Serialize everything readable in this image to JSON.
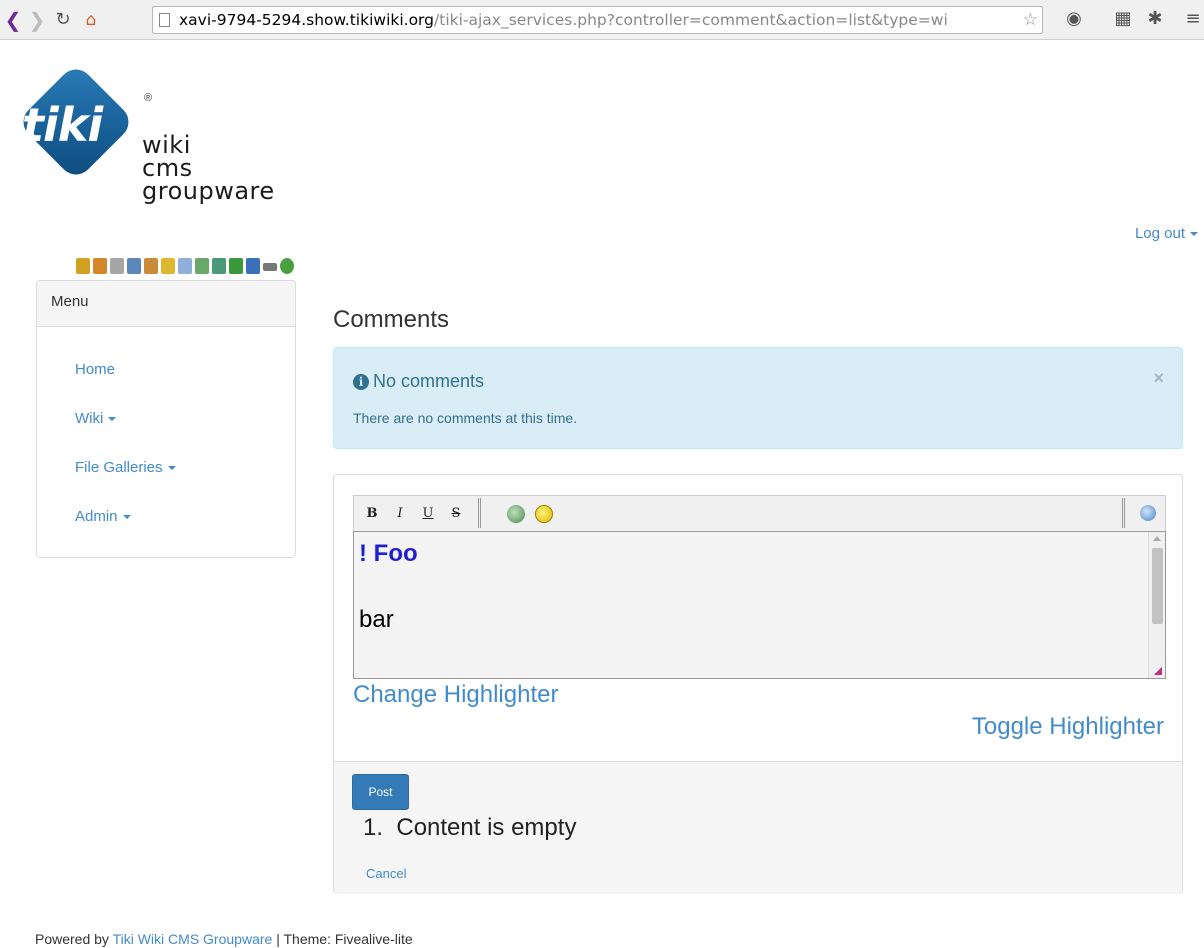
{
  "browser": {
    "url_host": "xavi-9794-5294.show.tikiwiki.org",
    "url_path": "/tiki-ajax_services.php?controller=comment&action=list&type=wi",
    "icons": [
      "back-icon",
      "forward-icon",
      "reload-icon",
      "home-icon",
      "page-icon",
      "bookmark-star-icon",
      "globe-icon",
      "film-icon",
      "bug-icon",
      "menu-icon"
    ]
  },
  "logo": {
    "mark": "tiki",
    "registered": "®",
    "line1": "wiki",
    "line2": "cms",
    "line3": "groupware"
  },
  "user": {
    "logout_label": "Log out"
  },
  "adminbar": {
    "icons": [
      "wand-icon",
      "home-icon",
      "wrench-icon",
      "user-icon",
      "users-icon",
      "key-icon",
      "modules-icon",
      "refresh-icon",
      "export-icon",
      "puzzle-icon",
      "book-icon",
      "minimize-icon",
      "bug-icon"
    ]
  },
  "menu": {
    "title": "Menu",
    "items": [
      {
        "label": "Home",
        "dropdown": false
      },
      {
        "label": "Wiki",
        "dropdown": true
      },
      {
        "label": "File Galleries",
        "dropdown": true
      },
      {
        "label": "Admin",
        "dropdown": true
      }
    ]
  },
  "main": {
    "title": "Comments",
    "alert": {
      "title": "No comments",
      "body": "There are no comments at this time.",
      "close": "×"
    },
    "toolbar": {
      "bold": "B",
      "italic": "I",
      "underline": "U",
      "strike": "S",
      "icons": [
        "image-icon",
        "smiley-icon",
        "help-icon"
      ]
    },
    "editor": {
      "line1": "! Foo",
      "line2": "bar"
    },
    "change_highlighter": "Change Highlighter",
    "toggle_highlighter": "Toggle Highlighter",
    "post_label": "Post",
    "error_number": "1.",
    "error_text": "Content is empty",
    "cancel_label": "Cancel"
  },
  "footer": {
    "prefix": "Powered by ",
    "link": "Tiki Wiki CMS Groupware",
    "suffix": " | Theme: Fivealive-lite"
  }
}
